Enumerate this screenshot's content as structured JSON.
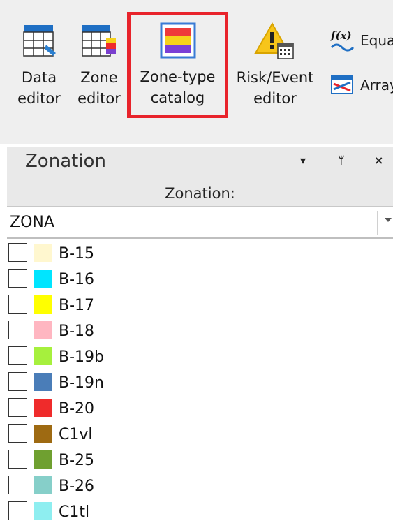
{
  "ribbon": {
    "data_editor": [
      "Data",
      "editor"
    ],
    "zone_editor": [
      "Zone",
      "editor"
    ],
    "zone_type_catalog": [
      "Zone-type",
      "catalog"
    ],
    "risk_event_editor": [
      "Risk/Event",
      "editor"
    ],
    "equation_label": "Equa",
    "array_label": "Array",
    "highlight_color": "#e8232b"
  },
  "panel": {
    "title": "Zonation",
    "controls": {
      "menu": "▾",
      "pin": "ᛘ",
      "close": "×"
    },
    "sub_label": "Zonation:",
    "combo_value": "ZONA"
  },
  "zones": [
    {
      "label": "B-15",
      "color": "#fff7cf"
    },
    {
      "label": "B-16",
      "color": "#00e5ff"
    },
    {
      "label": "B-17",
      "color": "#ffff00"
    },
    {
      "label": "B-18",
      "color": "#ffb6c1"
    },
    {
      "label": "B-19b",
      "color": "#a6f03d"
    },
    {
      "label": "B-19n",
      "color": "#4a7db8"
    },
    {
      "label": "B-20",
      "color": "#ef2b2b"
    },
    {
      "label": "C1vl",
      "color": "#9e6a12"
    },
    {
      "label": "B-25",
      "color": "#6fa030"
    },
    {
      "label": "B-26",
      "color": "#86cfc9"
    },
    {
      "label": "C1tl",
      "color": "#8eeef0"
    }
  ]
}
